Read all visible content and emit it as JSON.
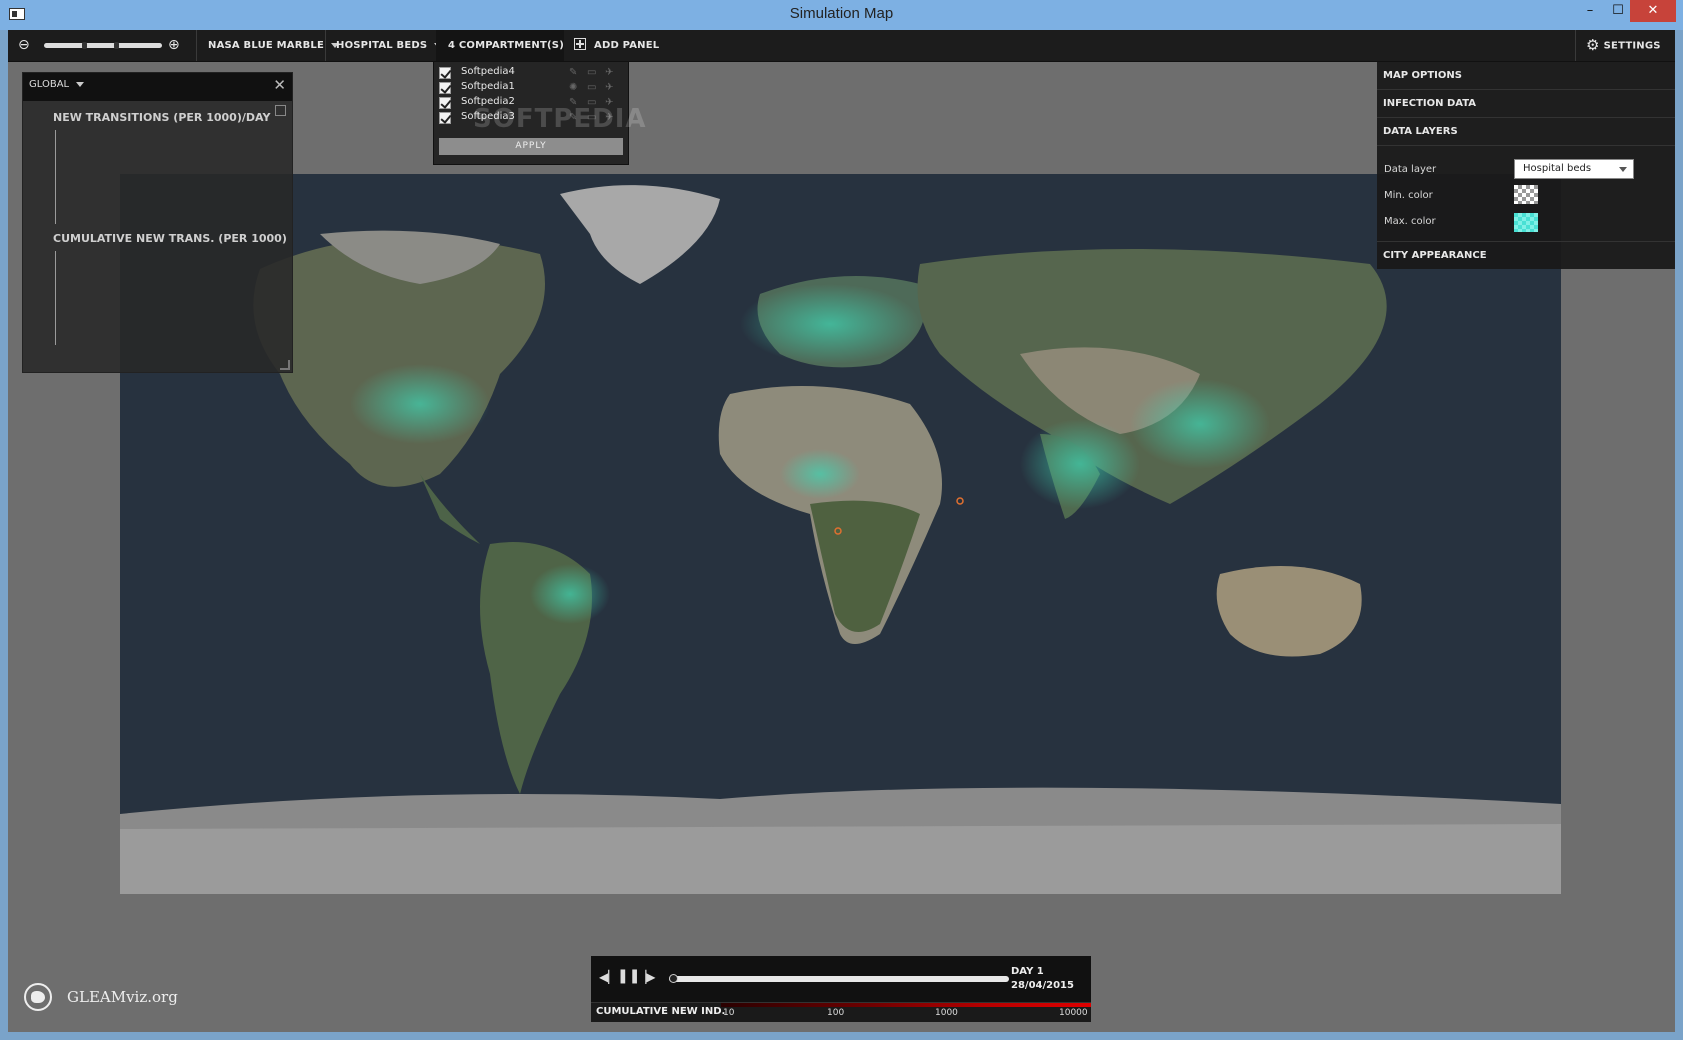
{
  "window": {
    "title": "Simulation Map",
    "minimize": "–",
    "maximize": "☐",
    "close": "✕"
  },
  "toolbar": {
    "zoom_out_icon": "zoom-out-icon",
    "zoom_in_icon": "zoom-in-icon",
    "basemap": "NASA BLUE MARBLE",
    "data_layer": "HOSPITAL BEDS",
    "compartments": "4 COMPARTMENT(S)",
    "add_panel": "ADD PANEL",
    "settings": "SETTINGS"
  },
  "compartment_menu": {
    "items": [
      {
        "name": "Softpedia4",
        "checked": true
      },
      {
        "name": "Softpedia1",
        "checked": true
      },
      {
        "name": "Softpedia2",
        "checked": true
      },
      {
        "name": "Softpedia3",
        "checked": true
      }
    ],
    "apply": "APPLY",
    "watermark": "SOFTPEDIA"
  },
  "global_panel": {
    "scope": "GLOBAL",
    "close": "✕",
    "chart1_title": "NEW TRANSITIONS (PER 1000)/DAY",
    "chart2_title": "CUMULATIVE NEW TRANS. (PER 1000)"
  },
  "settings_panel": {
    "map_options": "MAP OPTIONS",
    "infection_data": "INFECTION DATA",
    "data_layers": "DATA LAYERS",
    "data_layer_label": "Data layer",
    "data_layer_value": "Hospital beds",
    "min_color_label": "Min. color",
    "max_color_label": "Max. color",
    "city_appearance": "CITY APPEARANCE",
    "max_color": "#49e0d4"
  },
  "logo": {
    "text": "GLEAMviz.org"
  },
  "playback": {
    "day": "DAY 1",
    "date": "28/04/2015",
    "progress": 0,
    "legend_title": "CUMULATIVE NEW IND.",
    "legend_ticks": [
      "10",
      "100",
      "1000",
      "10000"
    ]
  },
  "colors": {
    "accent_teal": "#3fd6b4",
    "toolbar_bg": "#1c1c1c",
    "legend_red": "#e00000"
  }
}
